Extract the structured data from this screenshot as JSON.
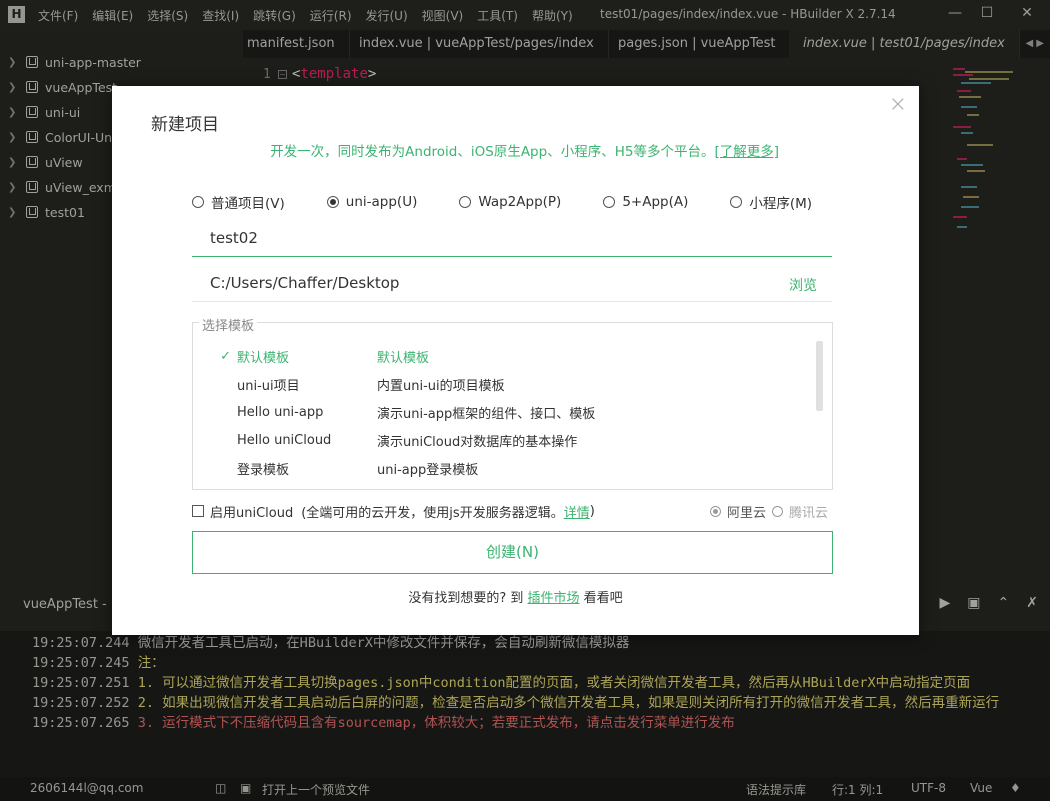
{
  "window": {
    "title": "test01/pages/index/index.vue - HBuilder X 2.7.14",
    "logo": "H"
  },
  "menu": [
    "文件(F)",
    "编辑(E)",
    "选择(S)",
    "查找(I)",
    "跳转(G)",
    "运行(R)",
    "发行(U)",
    "视图(V)",
    "工具(T)",
    "帮助(Y)"
  ],
  "sidebar": {
    "projects": [
      "uni-app-master",
      "vueAppTest",
      "uni-ui",
      "ColorUI-UniApp",
      "uView",
      "uView_exm",
      "test01"
    ]
  },
  "tabs": [
    "manifest.json",
    "index.vue | vueAppTest/pages/index",
    "pages.json | vueAppTest",
    "index.vue | test01/pages/index"
  ],
  "editor": {
    "line1": "1",
    "fold": "−",
    "code_open": "<",
    "code_tag": "template",
    "code_close": ">"
  },
  "dialog": {
    "title": "新建项目",
    "subtitle": "开发一次，同时发布为Android、iOS原生App、小程序、H5等多个平台。",
    "learn_more": "[了解更多]",
    "types": [
      {
        "label": "普通项目(V)",
        "selected": false
      },
      {
        "label": "uni-app(U)",
        "selected": true
      },
      {
        "label": "Wap2App(P)",
        "selected": false
      },
      {
        "label": "5+App(A)",
        "selected": false
      },
      {
        "label": "小程序(M)",
        "selected": false
      }
    ],
    "project_name": "test02",
    "location": "C:/Users/Chaffer/Desktop",
    "browse": "浏览",
    "template_legend": "选择模板",
    "templates": [
      {
        "name": "默认模板",
        "desc": "默认模板",
        "selected": true
      },
      {
        "name": "uni-ui项目",
        "desc": "内置uni-ui的项目模板",
        "selected": false
      },
      {
        "name": "Hello uni-app",
        "desc": "演示uni-app框架的组件、接口、模板",
        "selected": false
      },
      {
        "name": "Hello uniCloud",
        "desc": "演示uniCloud对数据库的基本操作",
        "selected": false
      },
      {
        "name": "登录模板",
        "desc": "uni-app登录模板",
        "selected": false
      }
    ],
    "unicloud_label": "启用uniCloud",
    "unicloud_desc": "(全端可用的云开发，使用js开发服务器逻辑。",
    "unicloud_link": "详情",
    "unicloud_end": ")",
    "provider_aliyun": "阿里云",
    "provider_tencent": "腾讯云",
    "create_button": "创建(N)",
    "footer_prefix": "没有找到想要的? 到",
    "footer_link": "插件市场",
    "footer_suffix": "看看吧",
    "check_mark": "✓",
    "close": "×"
  },
  "console": {
    "title": "vueAppTest - ",
    "logs": [
      {
        "ts": "19:25:07.244",
        "text": "微信开发者工具已启动，在HBuilderX中修改文件并保存，会自动刷新微信模拟器",
        "level": "info"
      },
      {
        "ts": "19:25:07.245",
        "text": "注：",
        "level": "warn"
      },
      {
        "ts": "19:25:07.251",
        "text": "1. 可以通过微信开发者工具切换pages.json中condition配置的页面，或者关闭微信开发者工具，然后再从HBuilderX中启动指定页面",
        "level": "warn"
      },
      {
        "ts": "19:25:07.252",
        "text": "2. 如果出现微信开发者工具启动后白屏的问题，检查是否启动多个微信开发者工具，如果是则关闭所有打开的微信开发者工具，然后再重新运行",
        "level": "warn"
      },
      {
        "ts": "19:25:07.265",
        "text": "3. 运行模式下不压缩代码且含有sourcemap，体积较大；若要正式发布，请点击发行菜单进行发布",
        "level": "err"
      }
    ]
  },
  "statusbar": {
    "user": "2606144l@qq.com",
    "preview": "打开上一个预览文件",
    "hint": "语法提示库",
    "position": "行:1  列:1",
    "encoding": "UTF-8",
    "lang": "Vue"
  }
}
